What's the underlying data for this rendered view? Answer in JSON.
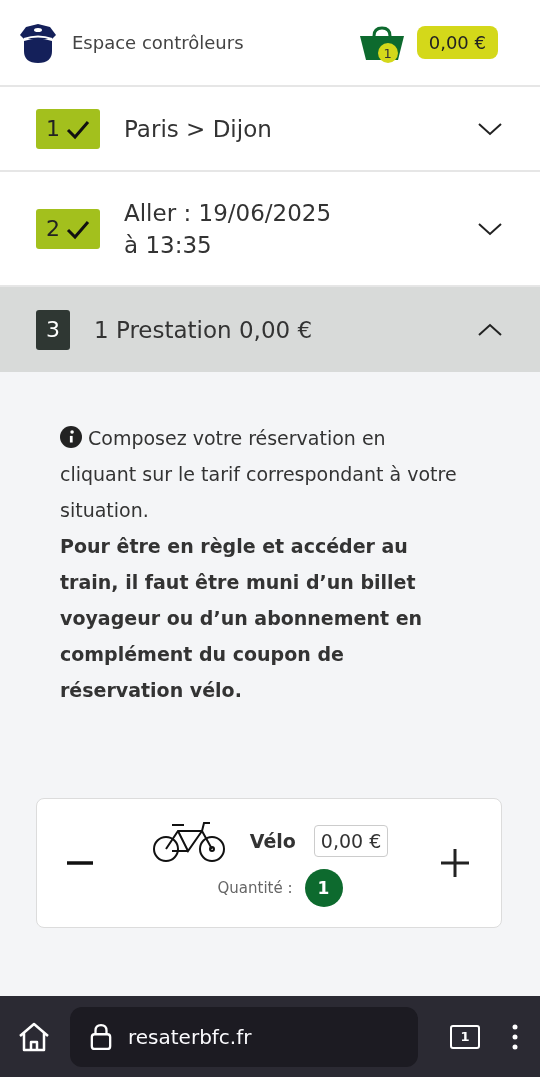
{
  "header": {
    "title": "Espace contrôleurs",
    "cart_count": "1",
    "cart_total": "0,00 €"
  },
  "steps": [
    {
      "number": "1",
      "done": true,
      "expanded": false,
      "lines": [
        "Paris > Dijon"
      ]
    },
    {
      "number": "2",
      "done": true,
      "expanded": false,
      "lines": [
        "Aller : 19/06/2025",
        "à 13:35"
      ]
    },
    {
      "number": "3",
      "done": false,
      "expanded": true,
      "lines": [
        "1 Prestation 0,00 €"
      ]
    }
  ],
  "info": {
    "text": "Composez votre réservation en cliquant sur le tarif correspondant à votre situation.",
    "warning": "Pour être en règle et accéder au train, il faut être muni d’un billet voyageur ou d’un abonnement en complément du coupon de réservation vélo."
  },
  "product": {
    "name": "Vélo",
    "price": "0,00 €",
    "quantity_label": "Quantité :",
    "quantity": "1"
  },
  "browser": {
    "url": "resaterbfc.fr",
    "tab_count": "1"
  }
}
